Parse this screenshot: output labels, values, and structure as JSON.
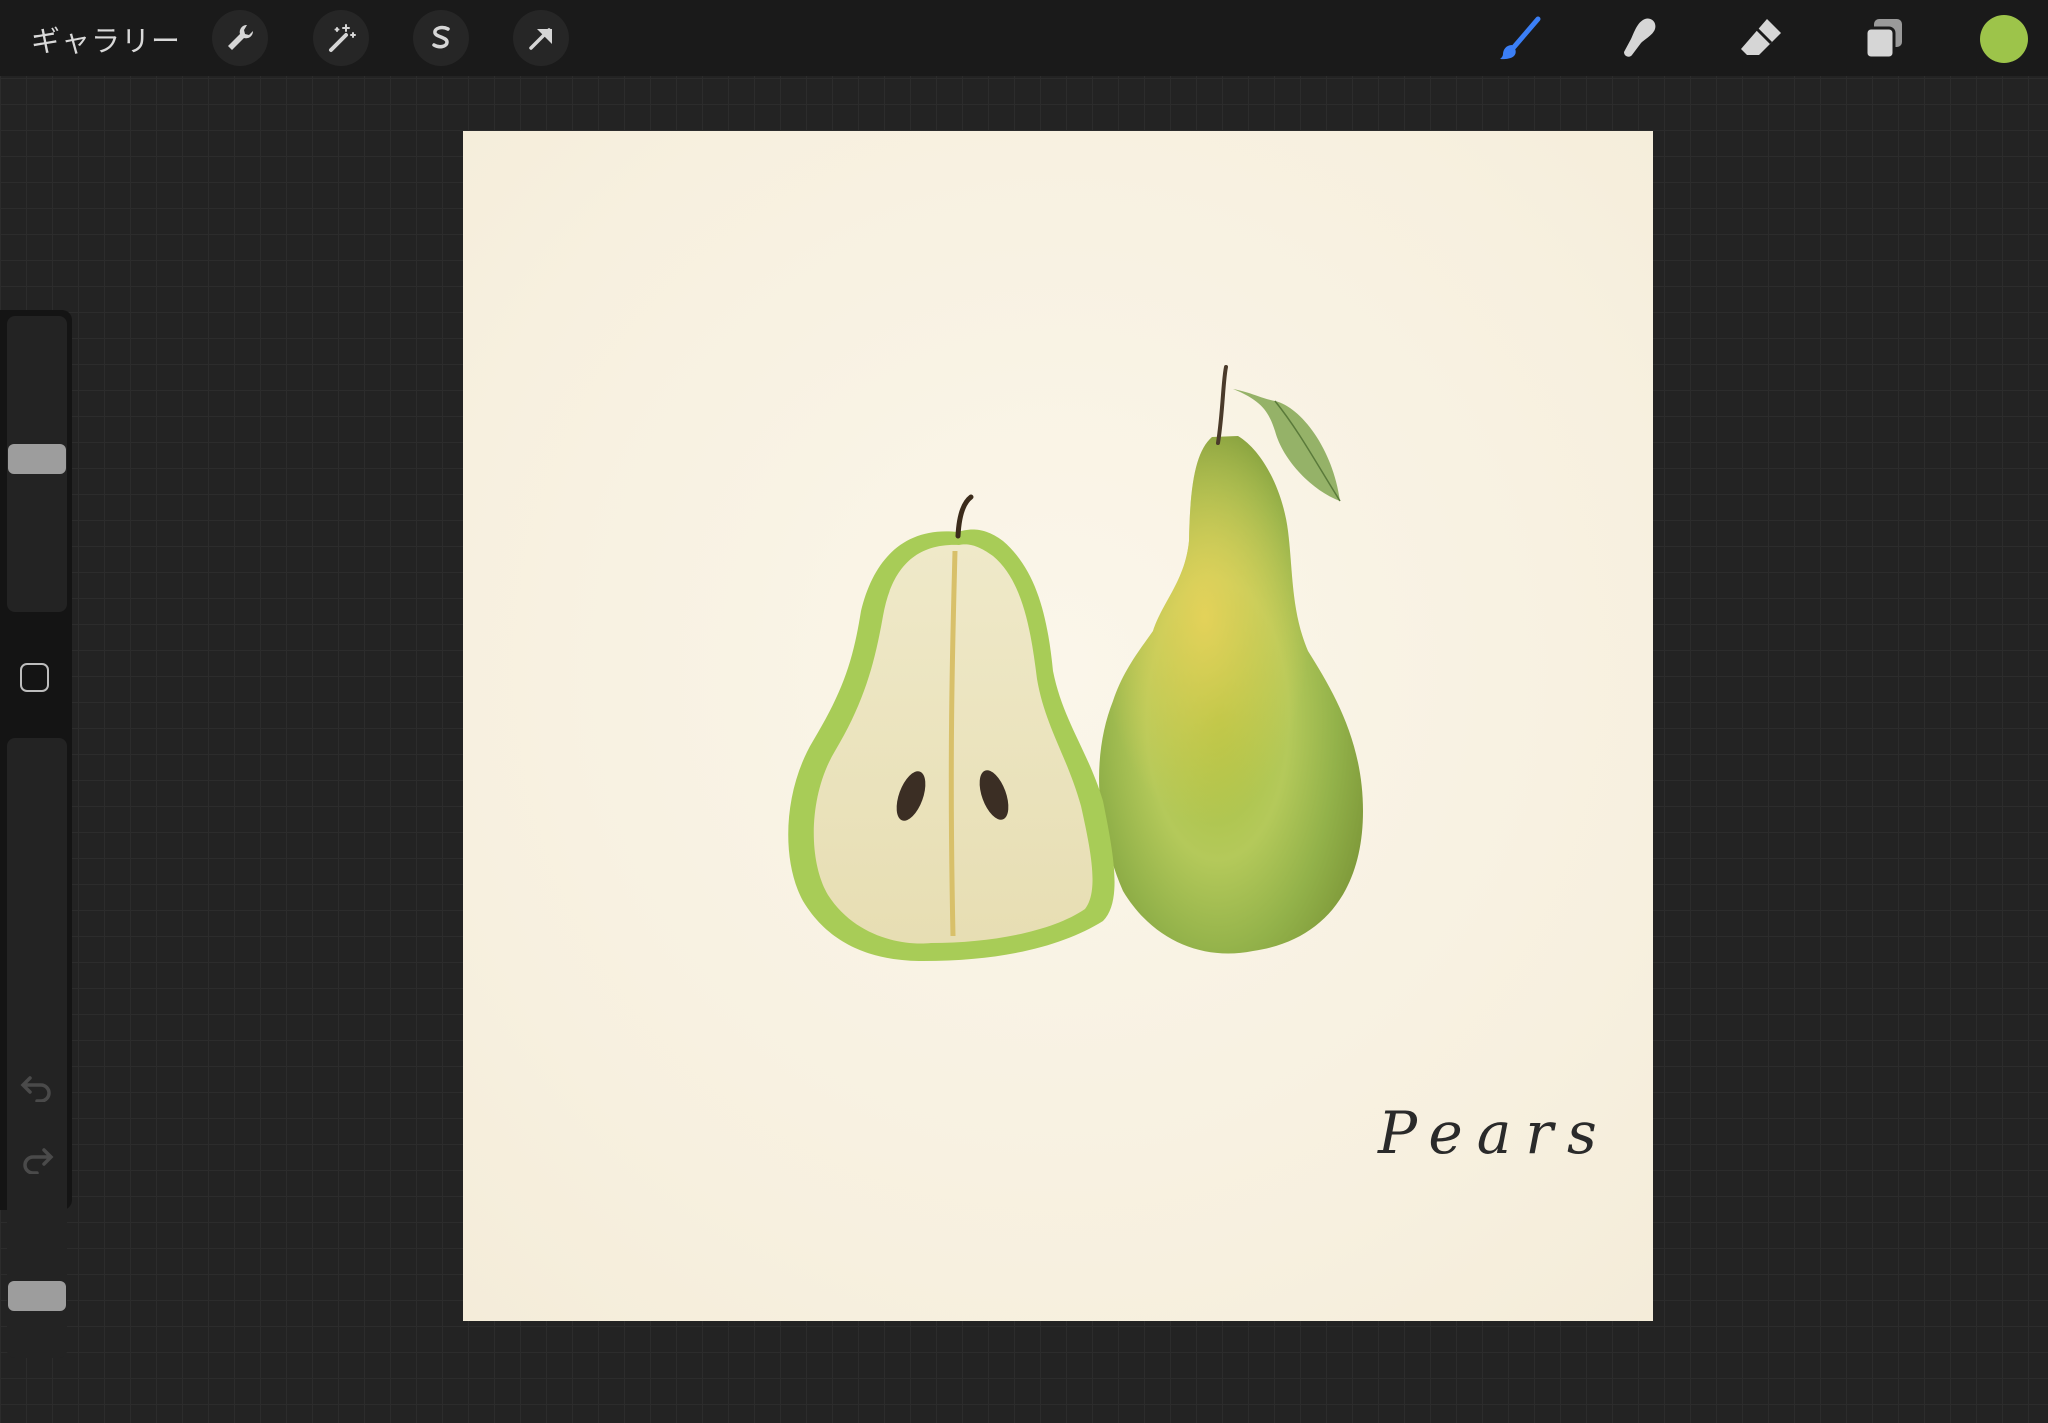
{
  "toolbar": {
    "gallery_label": "ギャラリー",
    "left_tools": [
      {
        "icon": "wrench-icon"
      },
      {
        "icon": "magic-wand-icon"
      },
      {
        "icon": "selection-icon"
      },
      {
        "icon": "transform-arrow-icon"
      }
    ],
    "right_tools": [
      {
        "icon": "brush-icon",
        "active": true
      },
      {
        "icon": "smudge-icon"
      },
      {
        "icon": "eraser-icon"
      },
      {
        "icon": "layers-icon"
      }
    ],
    "current_color": "#9dc44a",
    "active_tool_color": "#3b7ff6"
  },
  "sidebar": {
    "brush_size_level": 0.52,
    "opacity_level": 0.08
  },
  "canvas": {
    "background": "#f8f2e3",
    "caption": "Pears"
  }
}
